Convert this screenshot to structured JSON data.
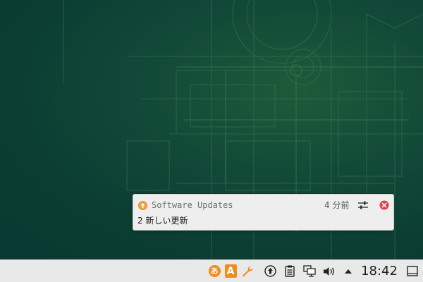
{
  "notification": {
    "app_icon": "update-arrow-icon",
    "app_name": "Software Updates",
    "time": "4 分前",
    "settings_icon": "sliders-icon",
    "close_icon": "close-circle-icon",
    "body": "2 新しい更新"
  },
  "taskbar": {
    "tray": [
      {
        "id": "ime-hiragana",
        "icon": "ime-hiragana-icon",
        "label": "あ"
      },
      {
        "id": "ime-mode",
        "icon": "ime-mode-icon",
        "label": "A"
      },
      {
        "id": "ime-tools",
        "icon": "wrench-icon"
      },
      {
        "id": "updates",
        "icon": "update-arrow-icon"
      },
      {
        "id": "clipboard",
        "icon": "clipboard-icon"
      },
      {
        "id": "network",
        "icon": "network-icon"
      },
      {
        "id": "volume",
        "icon": "volume-icon"
      },
      {
        "id": "expand",
        "icon": "triangle-up-icon"
      }
    ],
    "clock": "18:42",
    "show_desktop_icon": "window-icon"
  },
  "colors": {
    "desktop_bg": "#0a3d33",
    "accent_orange": "#f28c1a",
    "close_red": "#e0404a",
    "notification_bg": "#eeeeee",
    "taskbar_bg": "#e9e9e9"
  }
}
